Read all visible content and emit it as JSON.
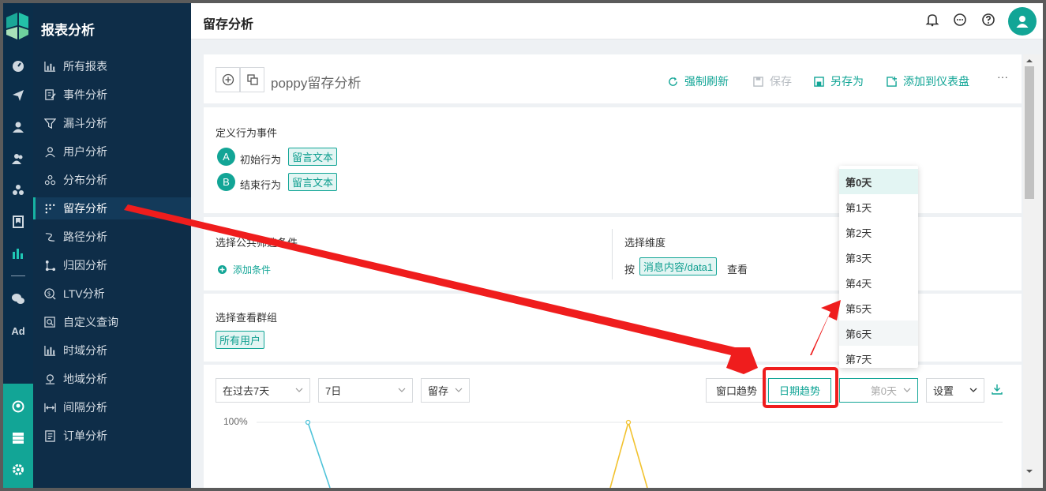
{
  "sidebar": {
    "title": "报表分析",
    "active_index": 5,
    "items": [
      {
        "label": "所有报表",
        "icon": "bar-chart-icon"
      },
      {
        "label": "事件分析",
        "icon": "edit-document-icon"
      },
      {
        "label": "漏斗分析",
        "icon": "funnel-icon"
      },
      {
        "label": "用户分析",
        "icon": "user-icon"
      },
      {
        "label": "分布分析",
        "icon": "distribution-icon"
      },
      {
        "label": "留存分析",
        "icon": "retention-dots-icon"
      },
      {
        "label": "路径分析",
        "icon": "path-icon"
      },
      {
        "label": "归因分析",
        "icon": "attribution-icon"
      },
      {
        "label": "LTV分析",
        "icon": "ltv-icon"
      },
      {
        "label": "自定义查询",
        "icon": "custom-query-icon"
      },
      {
        "label": "时域分析",
        "icon": "time-chart-icon"
      },
      {
        "label": "地域分析",
        "icon": "location-icon"
      },
      {
        "label": "间隔分析",
        "icon": "interval-icon"
      },
      {
        "label": "订单分析",
        "icon": "order-icon"
      }
    ]
  },
  "rail": {
    "icons": [
      "dashboard-icon",
      "send-icon",
      "user-icon",
      "users-icon",
      "cluster-icon",
      "bookmark-icon",
      "stats-icon",
      "wechat-icon"
    ],
    "ad_label": "Ad",
    "bottom_icons": [
      "team-icon",
      "list-icon",
      "gear-icon"
    ]
  },
  "header": {
    "title": "留存分析",
    "icons": [
      "bell-icon",
      "chat-icon",
      "help-icon",
      "avatar-icon"
    ]
  },
  "report": {
    "name": "poppy留存分析",
    "actions": [
      {
        "label": "强制刷新",
        "icon": "refresh-icon",
        "enabled": true
      },
      {
        "label": "保存",
        "icon": "save-icon",
        "enabled": false
      },
      {
        "label": "另存为",
        "icon": "save-as-icon",
        "enabled": true
      },
      {
        "label": "添加到仪表盘",
        "icon": "add-dashboard-icon",
        "enabled": true
      }
    ],
    "more": "···"
  },
  "events": {
    "title": "定义行为事件",
    "start": {
      "badge": "A",
      "label": "初始行为",
      "tag": "留言文本"
    },
    "end": {
      "badge": "B",
      "label": "结束行为",
      "tag": "留言文本"
    }
  },
  "filters": {
    "title": "选择公共筛选条件",
    "add_label": "添加条件",
    "dimension_title": "选择维度",
    "by": "按",
    "dimension_tag": "消息内容/data1",
    "view": "查看"
  },
  "groups": {
    "title": "选择查看群组",
    "tag": "所有用户"
  },
  "controls": {
    "range": "在过去7天",
    "granularity": "7日",
    "metric": "留存",
    "window_trend": "窗口趋势",
    "date_trend": "日期趋势",
    "day_select": "第0天",
    "settings": "设置"
  },
  "dropdown": {
    "options": [
      "第0天",
      "第1天",
      "第2天",
      "第3天",
      "第4天",
      "第5天",
      "第6天",
      "第7天"
    ],
    "selected": 0,
    "hovered": 6
  },
  "chart_data": {
    "type": "line",
    "ytick": "100%",
    "series": [
      {
        "color": "#4fc3d9",
        "peak": 1.0
      },
      {
        "color": "#f2c22e",
        "peak": 1.0
      }
    ]
  },
  "colors": {
    "accent": "#12a596",
    "sidebar": "#0e2d48",
    "annotation": "#ef1d1d"
  }
}
